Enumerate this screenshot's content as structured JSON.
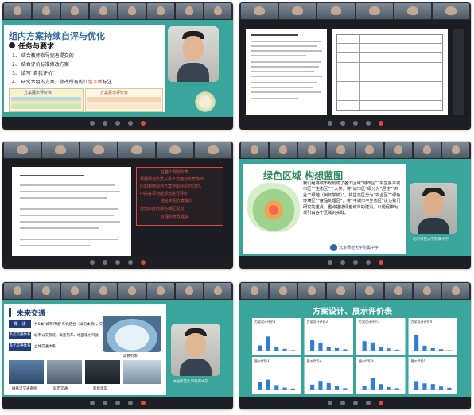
{
  "panel1": {
    "slide_title": "组内方案持续自评与优化",
    "section_heading": "任务与要求",
    "items": [
      "1、 结合教师指导完善提交的",
      "2、 结合评价标准修改方案",
      "3、 填写“自我评价”",
      "4、 研究本组的方案，修改所有的"
    ],
    "item4_highlight": "红色字体",
    "item4_suffix": "标注",
    "table_left_header": "方案展示评价表",
    "table_right_header": "方案展示评价表"
  },
  "panel3": {
    "red_box_lines": [
      "在整个规划方案",
      "根据规划方案从多个方面对方案作出",
      "比如根据规划方案作出评价的同时，",
      "中的各项功能规划进行评价",
      "结合本组方案提出",
      "增加对应的绿色城区规划，",
      "合理的修改建议"
    ]
  },
  "panel4": {
    "slide_title": "绿色区域 构想蓝图",
    "paragraph": "我们组将城市规划成了各个区域“城市区”“平生县平城市区”“生态区”个大类。将“城市区”细分为“居住”“商业”“绿地（树如学校）”。将生态区分为“农业区”“绿色环境区”“度品处理区”，将“丰城市平生态区”设为我们研究的重点，重点描述绿色城市的建设，以便促带为现引由各个区域的实践。",
    "footer": "北京师范大学附属中学",
    "presenter_label": "北京师范大学附属中学"
  },
  "panel5": {
    "banner_title": "未来交通",
    "rows": [
      {
        "label": "概　述",
        "value": "共5类“城市环境”有机结合（详见本期》，交通网络"
      },
      {
        "label": "多元交通体系",
        "value": "城市公交系统、高速列车、地面电力驾驶"
      },
      {
        "label": "多元交通体系",
        "value": "立体交通体系"
      }
    ],
    "image_captions": [
      "高铁列车",
      "磁悬浮交通系统",
      "城市交通",
      "新能源车"
    ],
    "presenter_label": "中国师范大学附属中学"
  },
  "panel6": {
    "slide_title": "方案设计、展示评价表",
    "chart_captions": [
      "方案设计评价1",
      "方案设计评价2",
      "方案设计评价3",
      "方案设计评价4",
      "展示评价1",
      "展示评价2",
      "展示评价3",
      "展示评价4"
    ]
  },
  "colors": {
    "teal_background": "#3aa59a",
    "dark_frame": "#14161b",
    "accent_red": "#d9483b",
    "bar_blue": "#2f7fd6"
  },
  "chart_data": [
    {
      "type": "bar",
      "categories": [
        "A",
        "B",
        "C",
        "D",
        "E"
      ],
      "values": [
        21,
        57,
        13,
        7,
        2
      ]
    },
    {
      "type": "bar",
      "categories": [
        "A",
        "B",
        "C",
        "D",
        "E"
      ],
      "values": [
        42,
        29,
        14,
        10,
        5
      ]
    },
    {
      "type": "bar",
      "categories": [
        "A",
        "B",
        "C",
        "D",
        "E"
      ],
      "values": [
        38,
        33,
        16,
        9,
        4
      ]
    },
    {
      "type": "bar",
      "categories": [
        "A",
        "B",
        "C",
        "D",
        "E"
      ],
      "values": [
        62,
        20,
        10,
        6,
        2
      ]
    },
    {
      "type": "bar",
      "categories": [
        "A",
        "B",
        "C",
        "D",
        "E"
      ],
      "values": [
        30,
        40,
        18,
        8,
        4
      ]
    },
    {
      "type": "bar",
      "categories": [
        "A",
        "B",
        "C",
        "D",
        "E"
      ],
      "values": [
        20,
        35,
        26,
        14,
        5
      ]
    },
    {
      "type": "bar",
      "categories": [
        "A",
        "B",
        "C",
        "D",
        "E"
      ],
      "values": [
        15,
        48,
        22,
        10,
        5
      ]
    },
    {
      "type": "bar",
      "categories": [
        "A",
        "B",
        "C",
        "D",
        "E"
      ],
      "values": [
        34,
        25,
        22,
        12,
        7
      ]
    }
  ]
}
